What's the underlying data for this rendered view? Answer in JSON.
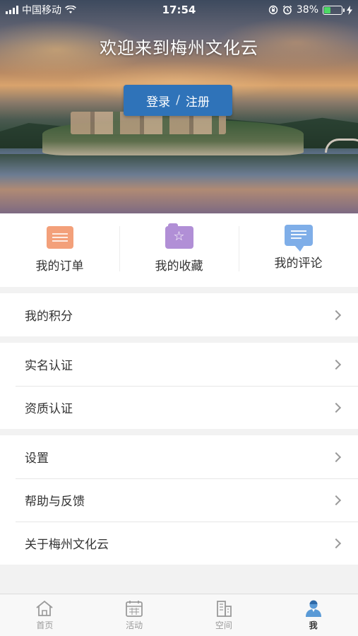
{
  "status_bar": {
    "carrier": "中国移动",
    "time": "17:54",
    "battery": "38%",
    "battery_level": 0.38
  },
  "hero": {
    "title": "欢迎来到梅州文化云",
    "login_label": "登录",
    "separator": "/",
    "register_label": "注册"
  },
  "quick_links": [
    {
      "label": "我的订单",
      "icon": "order-list-icon",
      "color": "#f3a07a"
    },
    {
      "label": "我的收藏",
      "icon": "favorite-folder-icon",
      "color": "#b18fd6"
    },
    {
      "label": "我的评论",
      "icon": "comment-bubble-icon",
      "color": "#7faee8"
    }
  ],
  "menu_groups": [
    {
      "items": [
        "我的积分"
      ]
    },
    {
      "items": [
        "实名认证",
        "资质认证"
      ]
    },
    {
      "items": [
        "设置",
        "帮助与反馈",
        "关于梅州文化云"
      ]
    }
  ],
  "tab_bar": {
    "tabs": [
      {
        "label": "首页",
        "icon": "home-icon",
        "active": false
      },
      {
        "label": "活动",
        "icon": "calendar-icon",
        "active": false
      },
      {
        "label": "空间",
        "icon": "building-icon",
        "active": false
      },
      {
        "label": "我",
        "icon": "user-icon",
        "active": true
      }
    ]
  }
}
